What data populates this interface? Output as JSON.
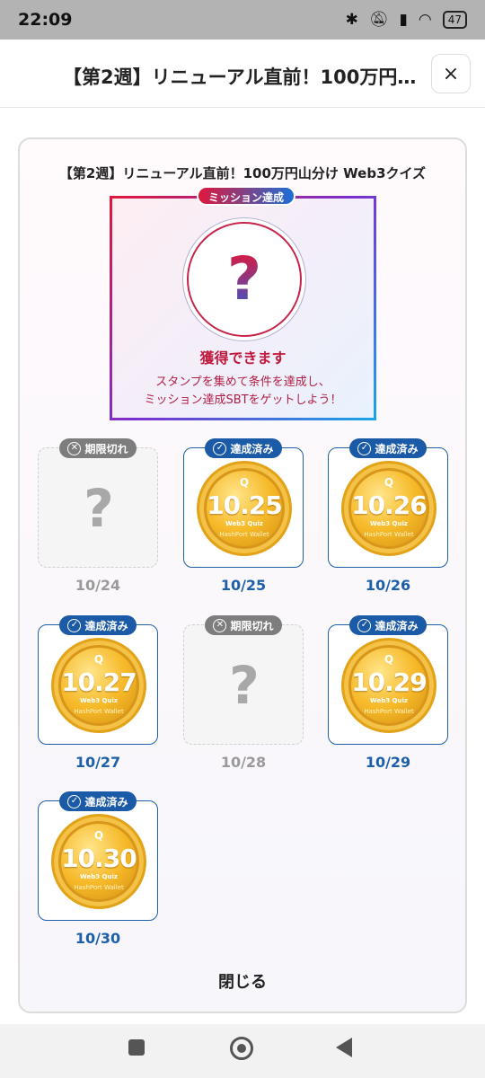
{
  "status_bar": {
    "time": "22:09",
    "battery": "47"
  },
  "header": {
    "title": "【第2週】リニューアル直前！100万円…",
    "close_icon": "×"
  },
  "card": {
    "title": "【第2週】リニューアル直前！100万円山分け Web3クイズ"
  },
  "mission": {
    "badge": "ミッション達成",
    "question_mark": "?",
    "status": "獲得できます",
    "desc_line1": "スタンプを集めて条件を達成し、",
    "desc_line2": "ミッション達成SBTをゲットしよう！"
  },
  "stamps": [
    {
      "date": "10/24",
      "status": "期限切れ",
      "icon": "✕",
      "q": "?"
    },
    {
      "date": "10/25",
      "status": "達成済み",
      "icon": "✓",
      "coin_date": "10.25",
      "coin_icon": "Q",
      "coin_sub": "Web3 Quiz",
      "coin_ring": "HashPort Wallet"
    },
    {
      "date": "10/26",
      "status": "達成済み",
      "icon": "✓",
      "coin_date": "10.26",
      "coin_icon": "Q",
      "coin_sub": "Web3 Quiz",
      "coin_ring": "HashPort Wallet"
    },
    {
      "date": "10/27",
      "status": "達成済み",
      "icon": "✓",
      "coin_date": "10.27",
      "coin_icon": "Q",
      "coin_sub": "Web3 Quiz",
      "coin_ring": "HashPort Wallet"
    },
    {
      "date": "10/28",
      "status": "期限切れ",
      "icon": "✕",
      "q": "?"
    },
    {
      "date": "10/29",
      "status": "達成済み",
      "icon": "✓",
      "coin_date": "10.29",
      "coin_icon": "Q",
      "coin_sub": "Web3 Quiz",
      "coin_ring": "HashPort Wallet"
    },
    {
      "date": "10/30",
      "status": "達成済み",
      "icon": "✓",
      "coin_date": "10.30",
      "coin_icon": "Q",
      "coin_sub": "Web3 Quiz",
      "coin_ring": "HashPort Wallet"
    }
  ],
  "footer": {
    "close_label": "閉じる"
  },
  "colors": {
    "accent_blue": "#1b5aa6",
    "accent_red": "#e0173b",
    "coin_gold": "#f6b928",
    "missed_gray": "#7d7d7d"
  }
}
